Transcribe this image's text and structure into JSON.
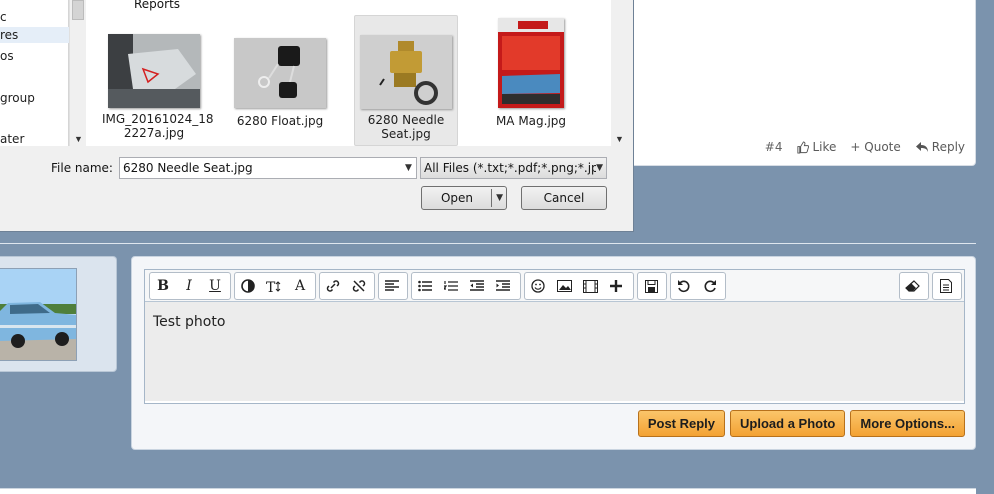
{
  "dialog": {
    "left_pane_items": [
      "c",
      "res",
      "os",
      "",
      "group",
      "",
      "ater"
    ],
    "selected_left_index": 1,
    "folder_label": "Reports",
    "files": [
      {
        "name": "IMG_20161024_182227a.jpg",
        "line1": "IMG_20161024_18",
        "line2": "2227a.jpg"
      },
      {
        "name": "6280 Float.jpg",
        "line1": "6280 Float.jpg",
        "line2": ""
      },
      {
        "name": "6280 Needle Seat.jpg",
        "line1": "6280 Needle",
        "line2": "Seat.jpg"
      },
      {
        "name": "MA Mag.jpg",
        "line1": "MA Mag.jpg",
        "line2": ""
      }
    ],
    "selected_file_index": 2,
    "file_name_label": "File name:",
    "file_name_value": "6280 Needle Seat.jpg",
    "filter_value": "All Files (*.txt;*.pdf;*.png;*.jpg;*",
    "open_label": "Open",
    "cancel_label": "Cancel"
  },
  "post": {
    "number": "#4",
    "like_label": "Like",
    "quote_label": "+ Quote",
    "reply_label": "Reply"
  },
  "editor": {
    "text": "Test photo",
    "toolbar_icons": [
      "bold-icon",
      "italic-icon",
      "underline-icon",
      "text-color-icon",
      "text-size-icon",
      "font-icon",
      "link-icon",
      "unlink-icon",
      "align-icon",
      "bullet-list-icon",
      "numbered-list-icon",
      "outdent-icon",
      "indent-icon",
      "smilie-icon",
      "image-icon",
      "media-icon",
      "insert-icon",
      "save-icon",
      "undo-icon",
      "redo-icon",
      "remove-format-icon",
      "source-icon"
    ],
    "bold": "B",
    "italic": "I",
    "underline": "U",
    "font": "A"
  },
  "buttons": {
    "post_reply": "Post Reply",
    "upload_photo": "Upload a Photo",
    "more_options": "More Options..."
  },
  "colors": {
    "background": "#7b93ad",
    "button_orange": "#f3a233"
  }
}
